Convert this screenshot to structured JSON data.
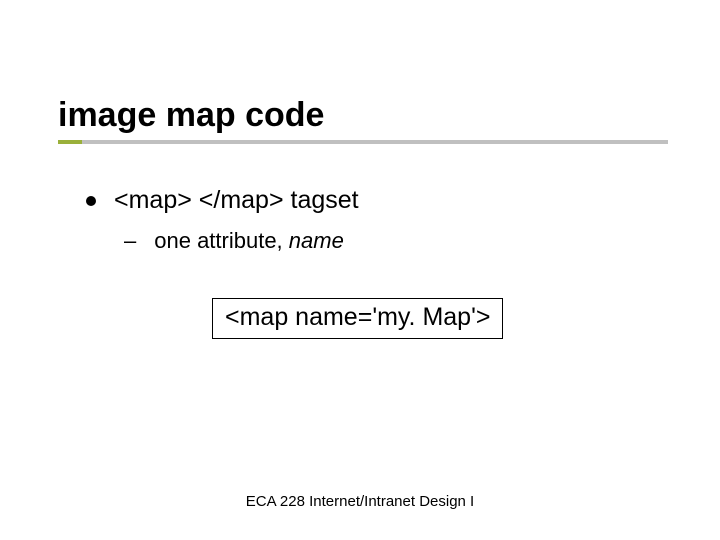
{
  "title": "image map code",
  "bullet": {
    "main": "<map>   </map>  tagset",
    "sub_prefix": "one attribute, ",
    "sub_italic": "name"
  },
  "code": "<map name='my. Map'>",
  "footer": "ECA 228  Internet/Intranet Design I"
}
